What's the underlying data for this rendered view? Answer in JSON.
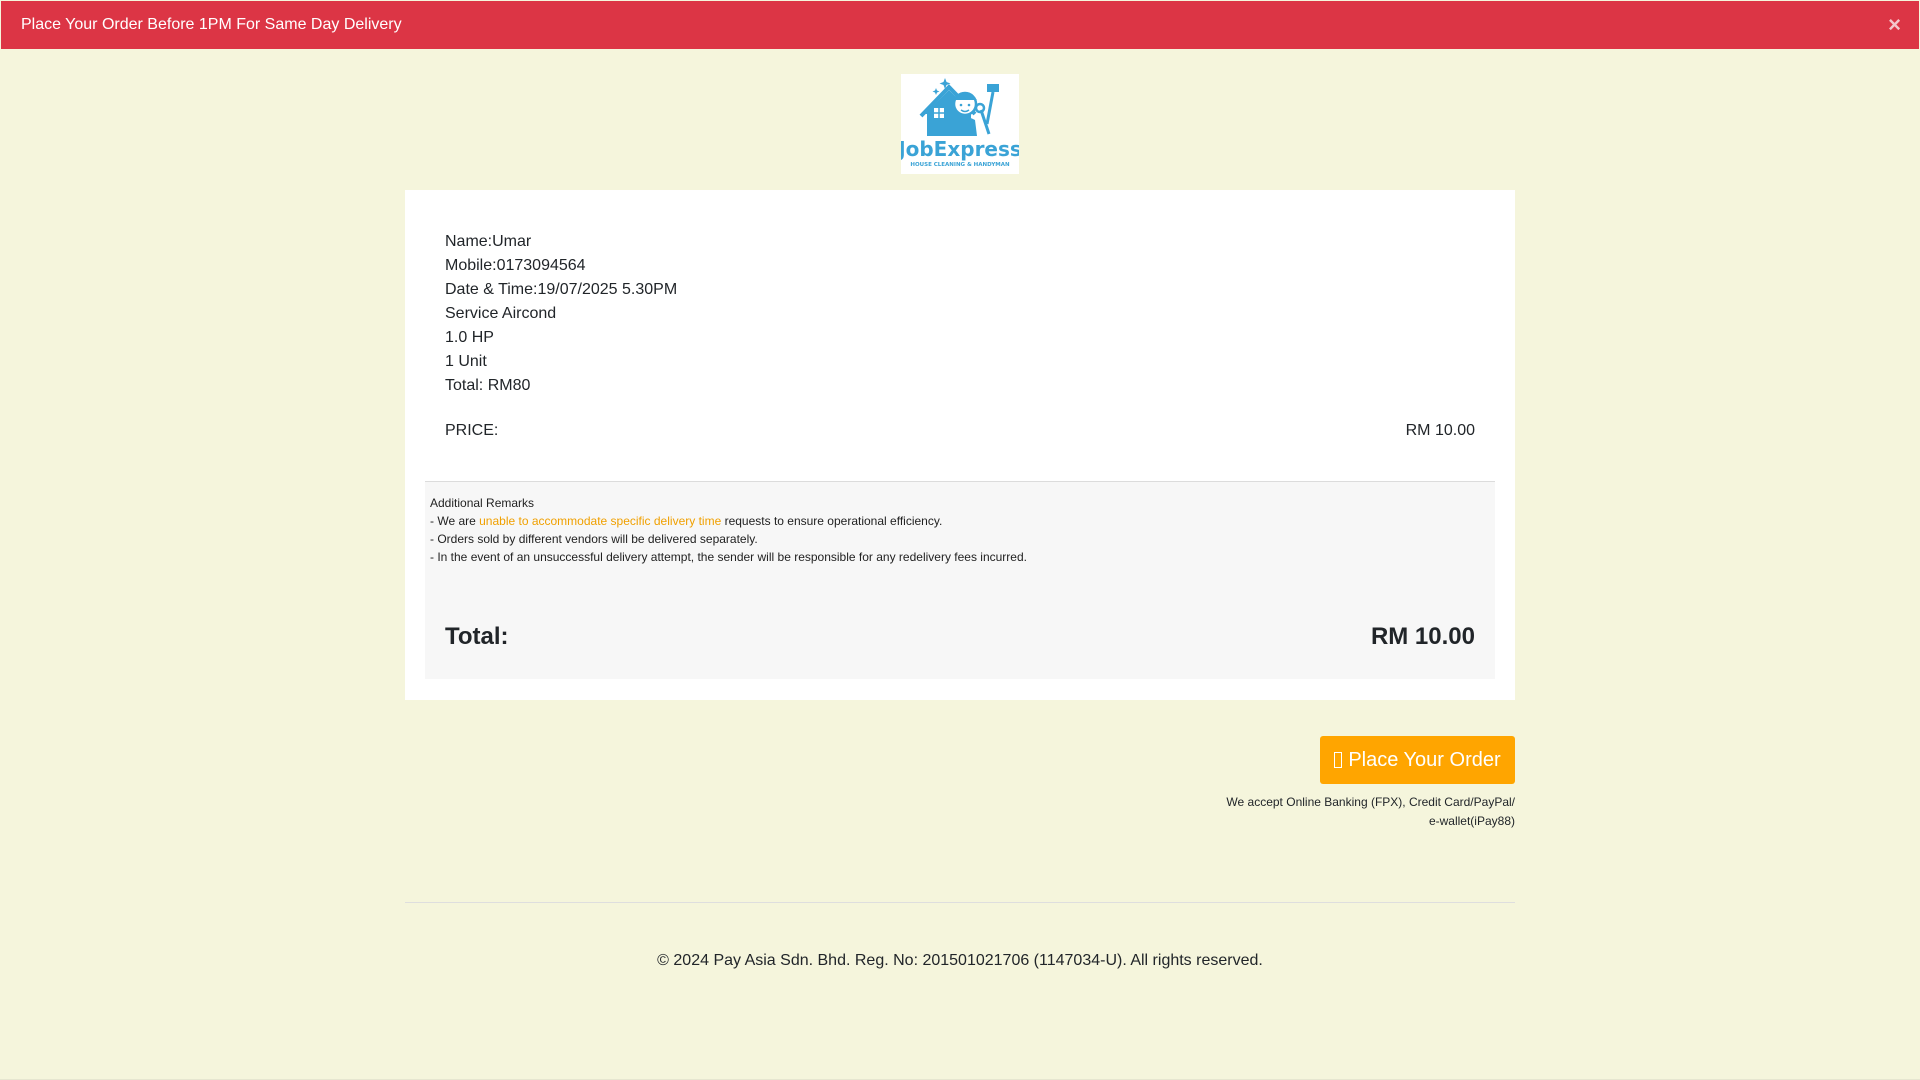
{
  "alert": {
    "message": "Place Your Order Before 1PM For Same Day Delivery",
    "close_symbol": "×",
    "color": "#dc3545"
  },
  "logo": {
    "brand": "JobExpress",
    "tagline": "HOUSE CLEANING & HANDYMAN",
    "color": "#3aa3d6"
  },
  "order": {
    "name": "Name:Umar",
    "mobile": "Mobile:0173094564",
    "datetime": "Date & Time:19/07/2025 5.30PM",
    "service": "Service Aircond",
    "capacity": "1.0 HP",
    "units": "1 Unit",
    "total_text": "Total: RM80",
    "price_label": "PRICE:",
    "price_value": "RM 10.00"
  },
  "remarks": {
    "title": "Additional Remarks",
    "line1_prefix": "- We are ",
    "line1_highlight": "unable to accommodate specific delivery time",
    "line1_suffix": " requests to ensure operational efficiency.",
    "line2": "- Orders sold by different vendors will be delivered separately.",
    "line3": "- In the event of an unsuccessful delivery attempt, the sender will be responsible for any redelivery fees incurred.",
    "highlight_color": "#f0a000"
  },
  "summary": {
    "total_label": "Total:",
    "total_value": "RM 10.00"
  },
  "actions": {
    "place_order_label": "Place Your Order",
    "place_order_icon": "cart-icon",
    "button_color": "#ffa500",
    "accept_line1": "We accept Online Banking (FPX), Credit Card/PayPal/",
    "accept_line2": "e-wallet(iPay88)"
  },
  "footer": {
    "copyright": "© 2024 Pay Asia Sdn. Bhd. Reg. No: 201501021706 (1147034-U). All rights reserved."
  }
}
